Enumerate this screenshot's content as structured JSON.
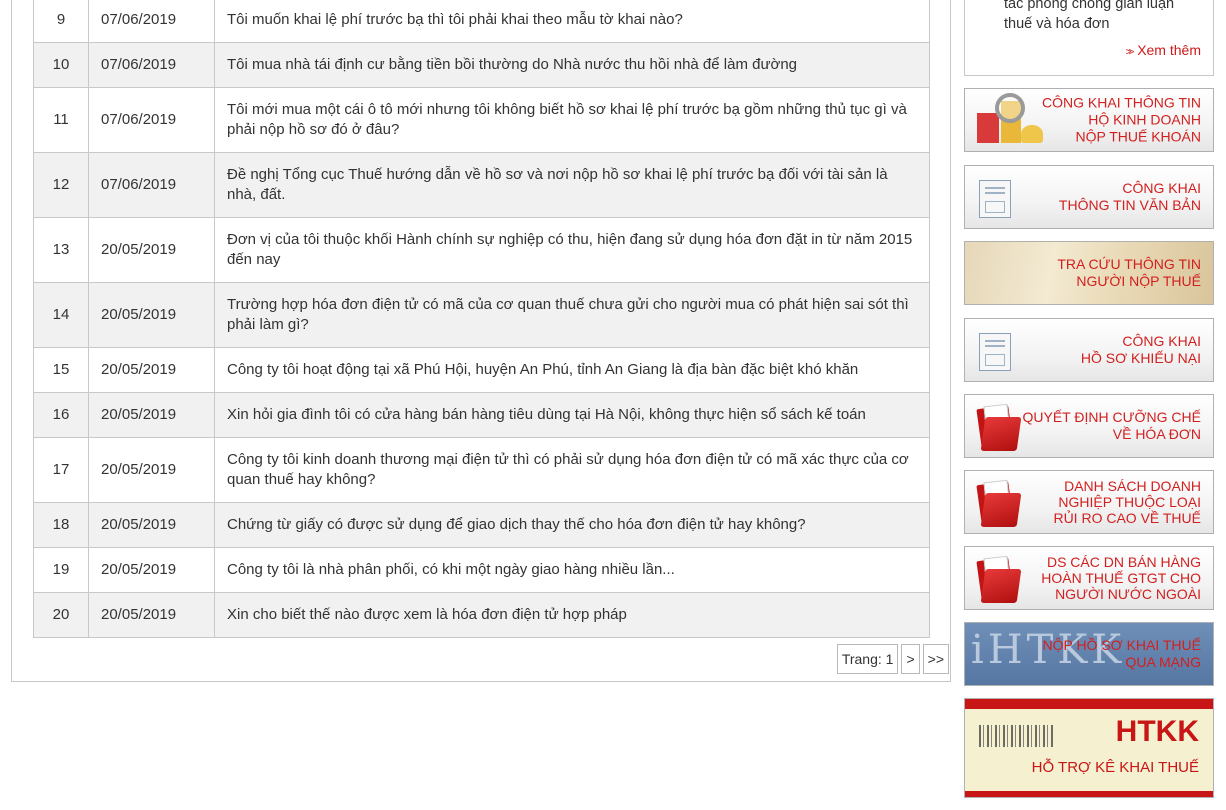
{
  "table": {
    "rows": [
      {
        "num": "9",
        "date": "07/06/2019",
        "question": "Tôi muốn khai lệ phí trước bạ thì tôi phải khai theo mẫu tờ khai nào?"
      },
      {
        "num": "10",
        "date": "07/06/2019",
        "question": "Tôi mua nhà tái định cư bằng tiền bồi thường do Nhà nước thu hồi nhà để làm đường"
      },
      {
        "num": "11",
        "date": "07/06/2019",
        "question": "Tôi mới mua một cái ô tô mới nhưng tôi không biết hồ sơ khai lệ phí trước bạ gồm những thủ tục gì và phải nộp hồ sơ đó ở đâu?"
      },
      {
        "num": "12",
        "date": "07/06/2019",
        "question": "Đề nghị Tổng cục Thuế hướng dẫn về hồ sơ và nơi nộp hồ sơ khai lệ phí trước bạ đối với tài sản là nhà, đất."
      },
      {
        "num": "13",
        "date": "20/05/2019",
        "question": "Đơn vị của tôi thuộc khối Hành chính sự nghiệp có thu, hiện đang sử dụng hóa đơn đặt in từ năm 2015 đến nay"
      },
      {
        "num": "14",
        "date": "20/05/2019",
        "question": "Trường hợp hóa đơn điện tử có mã của cơ quan thuế chưa gửi cho người mua có phát hiện sai sót thì phải làm gì?"
      },
      {
        "num": "15",
        "date": "20/05/2019",
        "question": "Công ty tôi hoạt động tại xã Phú Hội, huyện An Phú, tỉnh An Giang là địa bàn đặc biệt khó khăn"
      },
      {
        "num": "16",
        "date": "20/05/2019",
        "question": "Xin hỏi gia đình tôi có cửa hàng bán hàng tiêu dùng tại Hà Nội, không thực hiện sổ sách kế toán"
      },
      {
        "num": "17",
        "date": "20/05/2019",
        "question": "Công ty tôi kinh doanh thương mại điện tử thì có phải sử dụng hóa đơn điện tử có mã xác thực của cơ quan thuế hay không?"
      },
      {
        "num": "18",
        "date": "20/05/2019",
        "question": "Chứng từ giấy có được sử dụng để giao dịch thay thế cho hóa đơn điện tử hay không?"
      },
      {
        "num": "19",
        "date": "20/05/2019",
        "question": "Công ty tôi là nhà phân phối, có khi một ngày giao hàng nhiều lần..."
      },
      {
        "num": "20",
        "date": "20/05/2019",
        "question": "Xin cho biết thế nào được xem là hóa đơn điện tử hợp pháp"
      }
    ]
  },
  "pager": {
    "label": "Trang: 1",
    "next": ">",
    "last": ">>"
  },
  "sidebar": {
    "top_text": "tác phòng chống gian luận thuế và hóa đơn",
    "more_label": "Xem thêm",
    "more_arrow": ">>",
    "banners": [
      {
        "lines": [
          "CÔNG KHAI THÔNG TIN",
          "HỘ KINH DOANH",
          "NỘP THUẾ KHOÁN"
        ]
      },
      {
        "lines": [
          "CÔNG KHAI",
          "THÔNG TIN VĂN BẢN"
        ]
      },
      {
        "lines": [
          "TRA CỨU THÔNG TIN",
          "NGƯỜI NỘP THUẾ"
        ]
      },
      {
        "lines": [
          "CÔNG KHAI",
          "HỒ SƠ KHIẾU NẠI"
        ]
      },
      {
        "lines": [
          "QUYẾT ĐỊNH CƯỠNG CHẾ",
          "VỀ HÓA ĐƠN"
        ]
      },
      {
        "lines": [
          "DANH SÁCH DOANH",
          "NGHIỆP THUỘC LOẠI",
          "RỦI RO CAO VỀ THUẾ"
        ]
      },
      {
        "lines": [
          "DS CÁC DN BÁN HÀNG",
          "HOÀN THUẾ GTGT CHO",
          "NGƯỜI NƯỚC NGOÀI"
        ]
      },
      {
        "lines": [
          "NỘP HỒ SƠ KHAI THUẾ",
          "QUA MẠNG"
        ],
        "logo": "iHTKK"
      },
      {
        "title": "HTKK",
        "subtitle": "HỖ TRỢ KÊ KHAI THUẾ"
      }
    ]
  }
}
